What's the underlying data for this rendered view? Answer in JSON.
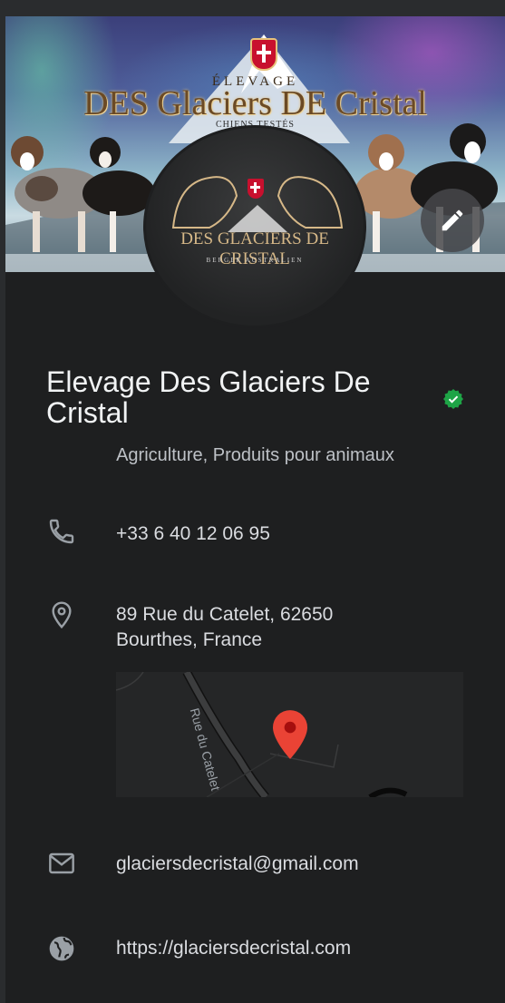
{
  "banner": {
    "elevage": "ÉLEVAGE",
    "title": "DES Glaciers DE Cristal",
    "subtitle": "CHIENS TESTÉS"
  },
  "avatar": {
    "title": "DES GLACIERS DE CRISTAL",
    "subtitle": "BERGER AUSTRALIEN"
  },
  "business": {
    "name": "Elevage Des Glaciers De Cristal",
    "category": "Agriculture, Produits pour animaux",
    "verified": true
  },
  "contact": {
    "phone": "+33 6 40 12 06 95",
    "address_line1": "89 Rue du Catelet, 62650",
    "address_line2": "Bourthes, France",
    "email": "glaciersdecristal@gmail.com",
    "website": "https://glaciersdecristal.com"
  },
  "map": {
    "street_label": "Rue du Catelet",
    "pin_color": "#ea4335"
  },
  "colors": {
    "background": "#1e1f20",
    "text_primary": "#f1f3f4",
    "text_secondary": "#bdc1c6",
    "icon": "#9aa0a6",
    "verified_green": "#1ea446"
  },
  "icons": {
    "edit": "pencil-icon",
    "verified": "verified-check-icon",
    "phone": "phone-icon",
    "address": "location-pin-icon",
    "email": "mail-icon",
    "website": "globe-icon"
  }
}
